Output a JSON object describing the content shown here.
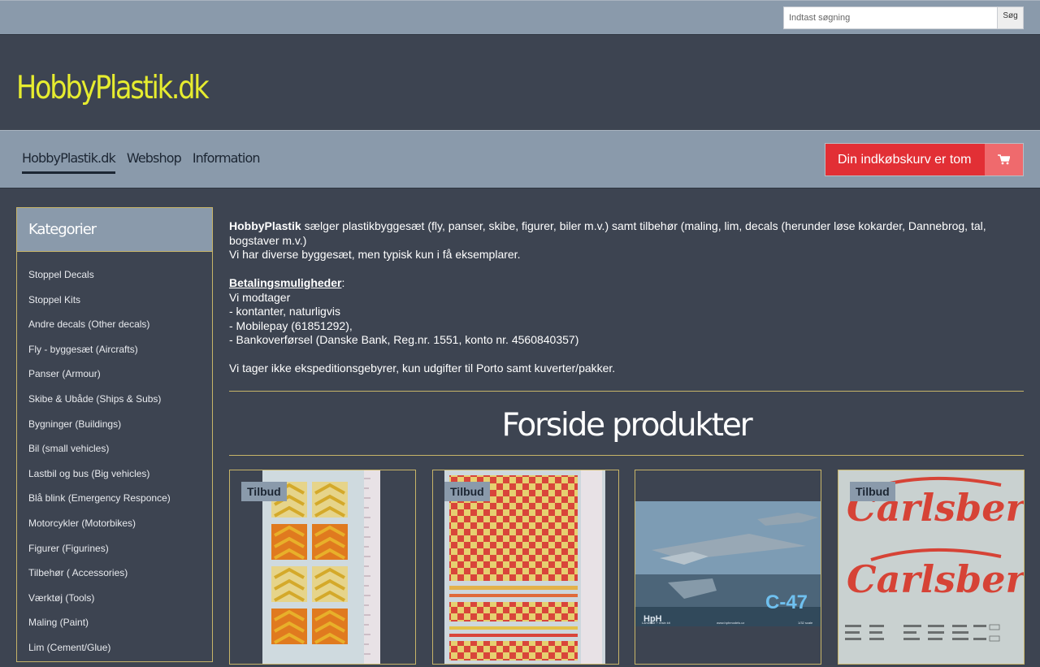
{
  "search": {
    "placeholder": "Indtast søgning",
    "button_label": "Søg"
  },
  "site": {
    "logo_text": "HobbyPlastik.dk"
  },
  "nav": {
    "items": [
      {
        "label": "HobbyPlastik.dk",
        "active": true
      },
      {
        "label": "Webshop",
        "active": false
      },
      {
        "label": "Information",
        "active": false
      }
    ]
  },
  "cart": {
    "label": "Din indkøbskurv er tom",
    "icon": "shopping-cart-icon"
  },
  "sidebar": {
    "title": "Kategorier",
    "items": [
      {
        "label": "Stoppel Decals"
      },
      {
        "label": "Stoppel Kits"
      },
      {
        "label": "Andre decals (Other decals)"
      },
      {
        "label": "Fly - byggesæt (Aircrafts)"
      },
      {
        "label": "Panser (Armour)"
      },
      {
        "label": "Skibe & Ubåde (Ships & Subs)"
      },
      {
        "label": "Bygninger (Buildings)"
      },
      {
        "label": "Bil (small vehicles)"
      },
      {
        "label": "Lastbil og bus (Big vehicles)"
      },
      {
        "label": "Blå blink (Emergency Responce)"
      },
      {
        "label": "Motorcykler (Motorbikes)"
      },
      {
        "label": "Figurer (Figurines)"
      },
      {
        "label": "Tilbehør ( Accessories)"
      },
      {
        "label": "Værktøj (Tools)"
      },
      {
        "label": "Maling (Paint)"
      },
      {
        "label": "Lim (Cement/Glue)"
      }
    ]
  },
  "intro": {
    "brand": "HobbyPlastik",
    "line1_rest": " sælger plastikbyggesæt (fly, panser, skibe, figurer, biler m.v.) samt tilbehør (maling, lim, decals (herunder løse kokarder, Dannebrog, tal, bogstaver m.v.)",
    "line2": "Vi har diverse byggesæt, men typisk kun i få eksemplarer.",
    "payment_heading": "Betalingsmuligheder",
    "payment_colon": ":",
    "payment_intro": "Vi modtager",
    "payment_options": [
      "- kontanter, naturligvis",
      "- Mobilepay (61851292),",
      "- Bankoverførsel (Danske Bank, Reg.nr. 1551, konto nr. 4560840357)"
    ],
    "fees_note": "Vi tager ikke ekspeditionsgebyrer, kun udgifter til Porto samt kuverter/pakker."
  },
  "products_section": {
    "title": "Forside produkter",
    "cards": [
      {
        "badge": "Tilbud"
      },
      {
        "badge": "Tilbud"
      },
      {
        "badge": "",
        "image_text_brand": "HpH",
        "image_text_model": "C-47",
        "image_caption": "Laminate + resin kit",
        "image_url_text": "www.hphmodels.cz",
        "image_scale": "1/32 scale"
      },
      {
        "badge": "Tilbud",
        "image_text": "Carlsberg"
      }
    ]
  },
  "colors": {
    "background": "#3d4451",
    "bar": "#8a9aab",
    "logo": "#e6ec2f",
    "accent_gold": "#c7b468",
    "cart_red": "#e22f35",
    "cart_icon_bg": "#ef6a6d"
  }
}
